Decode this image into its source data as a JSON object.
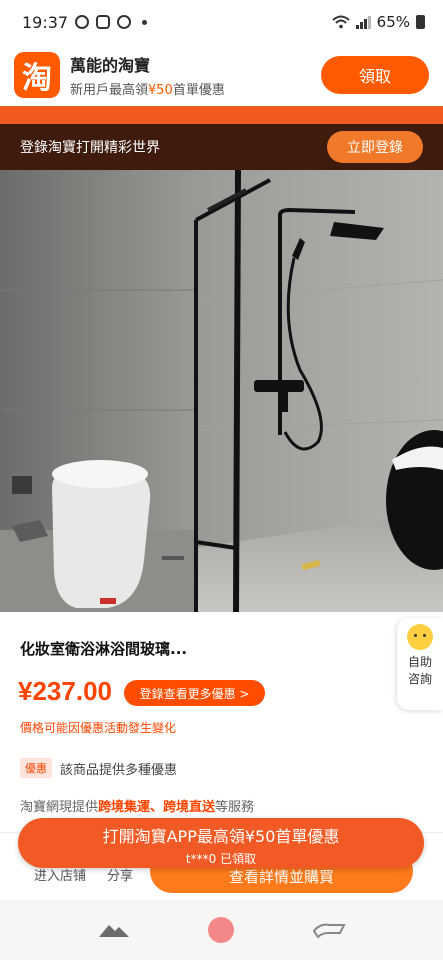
{
  "status_bar": {
    "time": "19:37",
    "battery": "65%"
  },
  "app_banner": {
    "logo_char": "淘",
    "name": "萬能的淘寶",
    "sub_before": "新用戶最高領",
    "sub_highlight": "¥50",
    "sub_after": "首單優惠",
    "claim_label": "領取"
  },
  "login_bar": {
    "text": "登錄淘寶打開精彩世界",
    "button": "立即登錄"
  },
  "product": {
    "title": "化妝室衛浴淋浴間玻璃...",
    "price": "¥237.00",
    "more_offers": "登錄查看更多優惠 >",
    "price_note": "價格可能因優惠活動發生變化",
    "promo_tag": "優惠",
    "promo_text": "該商品提供多種優惠",
    "service_before": "淘寶網現提供",
    "service_highlight": "跨境集運、跨境直送",
    "service_after": "等服務"
  },
  "help": {
    "label": "自助咨詢"
  },
  "action_bar": {
    "shop": "进入店铺",
    "share": "分享",
    "buy": "查看詳情並購買"
  },
  "open_app": {
    "title": "打開淘寶APP最高領¥50首單優惠",
    "sub": "t***0 已領取"
  },
  "colors": {
    "brand_orange": "#ff5a00",
    "price_red": "#ff4400",
    "login_bar_bg": "#3e1b0d"
  }
}
